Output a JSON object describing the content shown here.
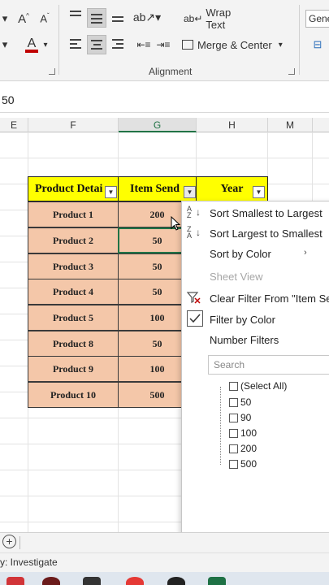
{
  "ribbon": {
    "font_grow": "A",
    "font_shrink": "A",
    "font_color_letter": "A",
    "wrap_text": "Wrap Text",
    "merge_center": "Merge & Center",
    "group_label": "Alignment",
    "number_format": "Gene"
  },
  "formula_bar": {
    "value": "50"
  },
  "columns": [
    "E",
    "F",
    "G",
    "H",
    "M"
  ],
  "table": {
    "headers": [
      "Product Detai",
      "Item Send",
      "Year"
    ],
    "rows": [
      [
        "Product 1",
        "200"
      ],
      [
        "Product 2",
        "50"
      ],
      [
        "Product 3",
        "50"
      ],
      [
        "Product 4",
        "50"
      ],
      [
        "Product 5",
        "100"
      ],
      [
        "Product 8",
        "50"
      ],
      [
        "Product 9",
        "100"
      ],
      [
        "Product 10",
        "500"
      ]
    ]
  },
  "dropdown": {
    "sort_asc": "Sort Smallest to Largest",
    "sort_desc": "Sort Largest to Smallest",
    "sort_color": "Sort by Color",
    "sheet_view": "Sheet View",
    "clear_filter": "Clear Filter From \"Item Sen",
    "filter_color": "Filter by Color",
    "number_filters": "Number Filters",
    "search_placeholder": "Search",
    "values": [
      "(Select All)",
      "50",
      "90",
      "100",
      "200",
      "500"
    ]
  },
  "status": {
    "text": "y: Investigate"
  },
  "colors": {
    "header_fill": "#ffff00",
    "cell_fill": "#f4c7a9",
    "accent": "#217346",
    "font_color_bar": "#c00000"
  }
}
